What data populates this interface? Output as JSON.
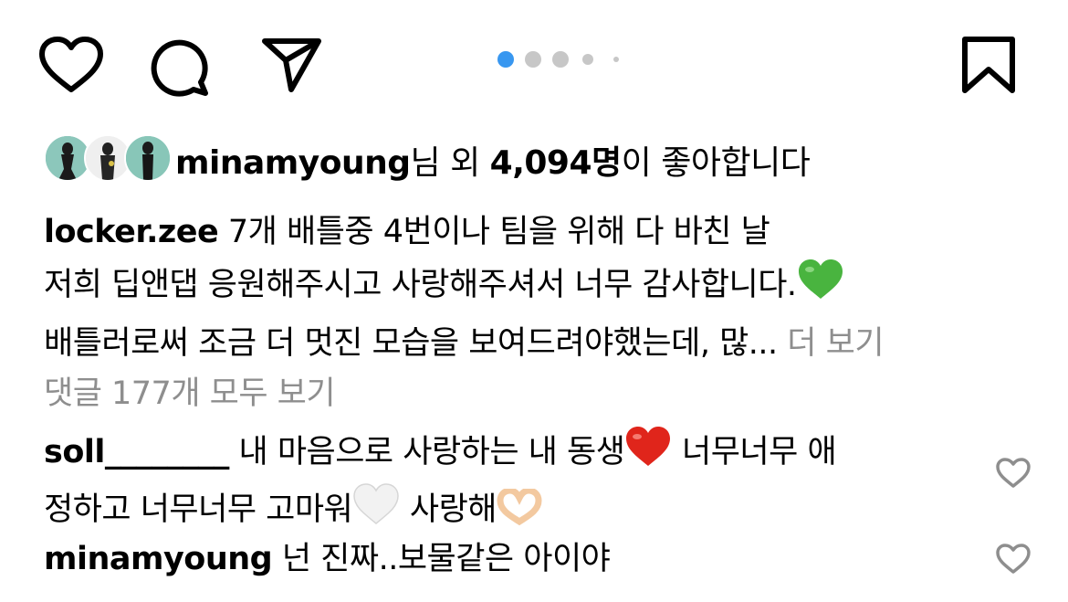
{
  "actions": {
    "like_icon": "heart-outline",
    "comment_icon": "speech-bubble",
    "share_icon": "paper-plane",
    "save_icon": "bookmark-outline",
    "active_color": "#3897f0",
    "inactive_dot_color": "#c7c7c7"
  },
  "carousel": {
    "count": 5,
    "active_index": 0
  },
  "likes": {
    "user": "minamyoung",
    "connector": "님 외 ",
    "count": "4,094명",
    "suffix": "이 좋아합니다"
  },
  "caption": {
    "username": "locker.zee",
    "line1": " 7개 배틀중 4번이나 팀을 위해 다 바친 날",
    "line2": "저희 딥앤댑 응원해주시고 사랑해주셔서 너무 감사합니다.",
    "line3": "배틀러로써 조금 더 멋진 모습을 보여드려야했는데, 많...",
    "more": " 더 보기"
  },
  "view_comments": "댓글 177개 모두 보기",
  "comments": [
    {
      "username": "soll________",
      "text_a": " 내 마음으로 사랑하는 내 동생",
      "text_b": " 너무너무 애",
      "text_c": "정하고 너무너무 고마워",
      "text_d": " 사랑해"
    },
    {
      "username": "minamyoung",
      "text": " 넌 진짜..보물같은 아이야"
    }
  ]
}
